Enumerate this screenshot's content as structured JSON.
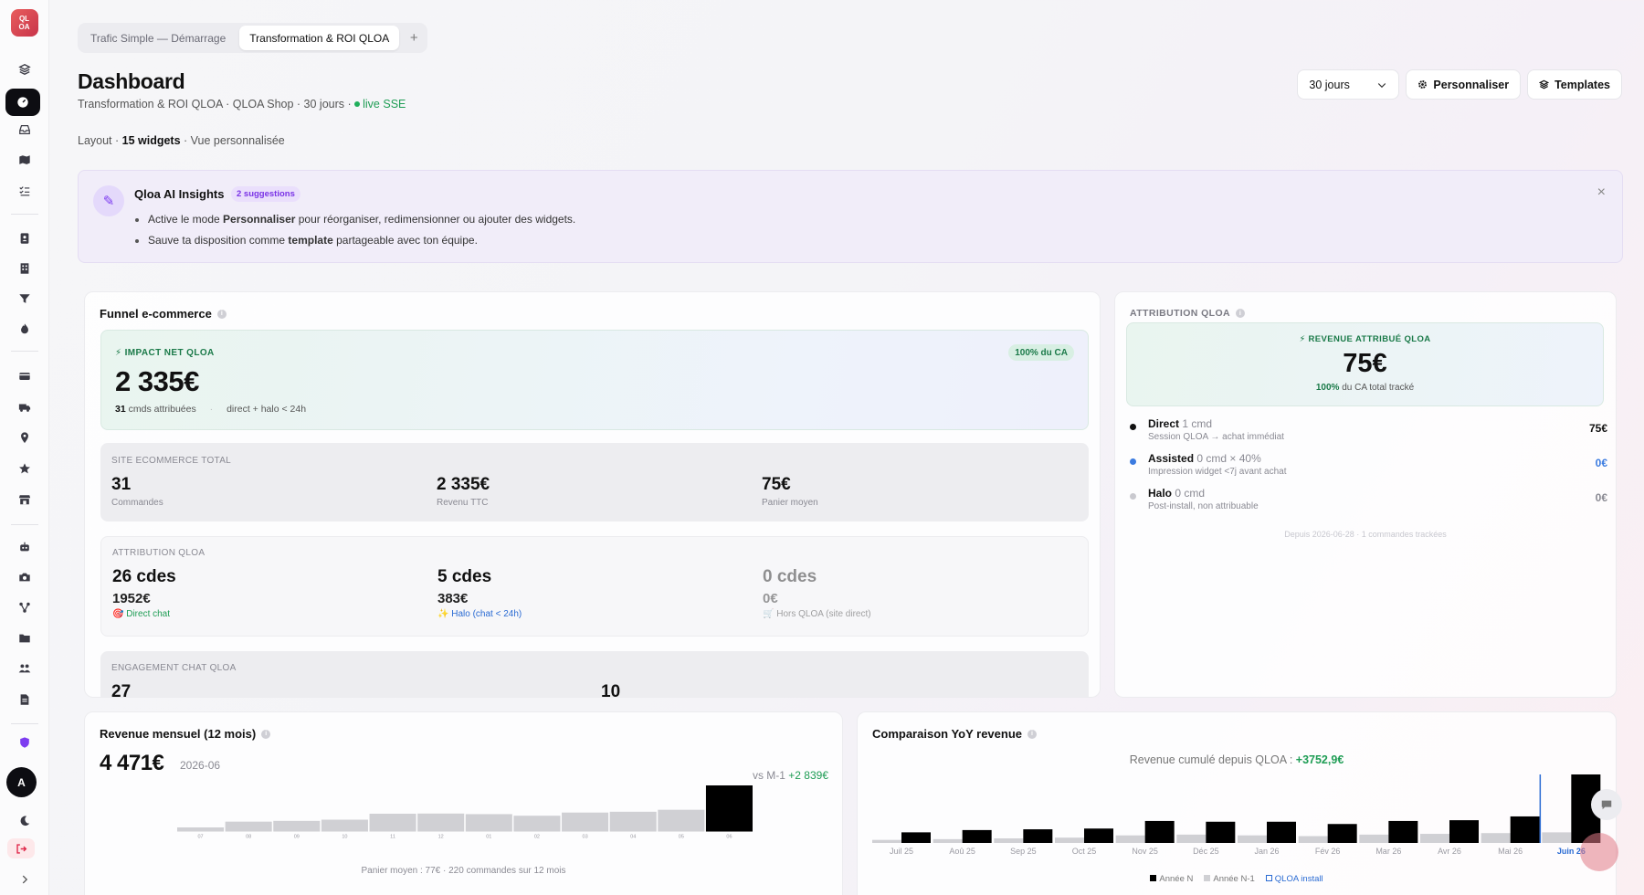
{
  "app": {
    "logo_text": "QL\nOA"
  },
  "tabs": [
    {
      "label": "Trafic Simple — Démarrage",
      "active": false
    },
    {
      "label": "Transformation & ROI QLOA",
      "active": true
    }
  ],
  "tab_add": "+",
  "header": {
    "title": "Dashboard",
    "subtitle_prefix": "Transformation & ROI QLOA · QLOA Shop · 30 jours · ",
    "live": "live SSE",
    "layout_prefix": "Layout · ",
    "layout_widgets": "15 widgets",
    "layout_suffix": " · Vue personnalisée"
  },
  "controls": {
    "period": "30 jours",
    "customize": "Personnaliser",
    "templates": "Templates"
  },
  "insights": {
    "title": "Qloa AI Insights",
    "badge": "2 suggestions",
    "item1_pre": "Active le mode ",
    "item1_bold": "Personnaliser",
    "item1_post": " pour réorganiser, redimensionner ou ajouter des widgets.",
    "item2_pre": "Sauve ta disposition comme ",
    "item2_bold": "template",
    "item2_post": " partageable avec ton équipe.",
    "close": "×"
  },
  "funnel": {
    "title": "Funnel e-commerce",
    "impact_label": "⚡ IMPACT NET QLOA",
    "impact_badge": "100% du CA",
    "impact_value": "2 335€",
    "impact_orders": "31",
    "impact_orders_label": " cmds attribuées",
    "impact_sep": "·",
    "impact_note": "direct + halo < 24h",
    "site_label": "SITE ECOMMERCE TOTAL",
    "site": [
      {
        "value": "31",
        "label": "Commandes"
      },
      {
        "value": "2 335€",
        "label": "Revenu TTC"
      },
      {
        "value": "75€",
        "label": "Panier moyen"
      }
    ],
    "attr_label": "ATTRIBUTION QLOA",
    "attr": [
      {
        "value": "26 cdes",
        "amount": "1952€",
        "label": "🎯 Direct chat"
      },
      {
        "value": "5 cdes",
        "amount": "383€",
        "label": "✨ Halo (chat < 24h)"
      },
      {
        "value": "0 cdes",
        "amount": "0€",
        "label": "🛒 Hors QLOA (site direct)"
      }
    ],
    "engage_label": "ENGAGEMENT CHAT QLOA",
    "engage": [
      "27",
      "10"
    ]
  },
  "attribution": {
    "title": "ATTRIBUTION QLOA",
    "box_label": "⚡ REVENUE ATTRIBUÉ QLOA",
    "box_value": "75€",
    "box_pct": "100%",
    "box_pct_suffix": " du CA total tracké",
    "rows": [
      {
        "name": "Direct",
        "count": " 1 cmd",
        "sub": "Session QLOA → achat immédiat",
        "value": "75€",
        "color": "#111111",
        "value_color": "#111111"
      },
      {
        "name": "Assisted",
        "count": " 0 cmd × 40%",
        "sub": "Impression widget <7j avant achat",
        "value": "0€",
        "color": "#3b7be0",
        "value_color": "#3b7be0"
      },
      {
        "name": "Halo",
        "count": " 0 cmd",
        "sub": "Post-install, non attribuable",
        "value": "0€",
        "color": "#c9c9cf",
        "value_color": "#8a8a93"
      }
    ],
    "footer": "Depuis 2026-06-28 · 1 commandes trackées"
  },
  "revenue": {
    "title": "Revenue mensuel (12 mois)",
    "value": "4 471€",
    "period": "2026-06",
    "vs_prefix": "vs M-1 ",
    "vs_delta": "+2 839€",
    "caption": "Panier moyen : 77€ · 220 commandes sur 12 mois"
  },
  "yoy": {
    "title": "Comparaison YoY revenue",
    "cum_prefix": "Revenue cumulé depuis QLOA : ",
    "cum_value": "+3752,9€"
  },
  "chart_data": [
    {
      "type": "bar",
      "categories": [
        "07",
        "08",
        "09",
        "10",
        "11",
        "12",
        "01",
        "02",
        "03",
        "04",
        "05",
        "06"
      ],
      "values": [
        210,
        500,
        540,
        600,
        900,
        910,
        880,
        800,
        960,
        1000,
        1100,
        2330
      ],
      "highlight_last": true
    },
    {
      "type": "bar",
      "categories": [
        "Juil 25",
        "Aoû 25",
        "Sep 25",
        "Oct 25",
        "Nov 25",
        "Déc 25",
        "Jan 26",
        "Fév 26",
        "Mar 26",
        "Avr 26",
        "Mai 26",
        "Juin 26"
      ],
      "series": [
        {
          "name": "Année N",
          "values": [
            700,
            850,
            900,
            950,
            1450,
            1400,
            1400,
            1250,
            1450,
            1500,
            1750,
            4700
          ],
          "color": "#000000"
        },
        {
          "name": "Année N-1",
          "values": [
            200,
            250,
            300,
            350,
            500,
            550,
            500,
            450,
            550,
            600,
            650,
            700
          ],
          "color": "#d0d0d4"
        }
      ],
      "install_marker": {
        "name": "QLOA install",
        "category": "Juin 26"
      }
    }
  ]
}
